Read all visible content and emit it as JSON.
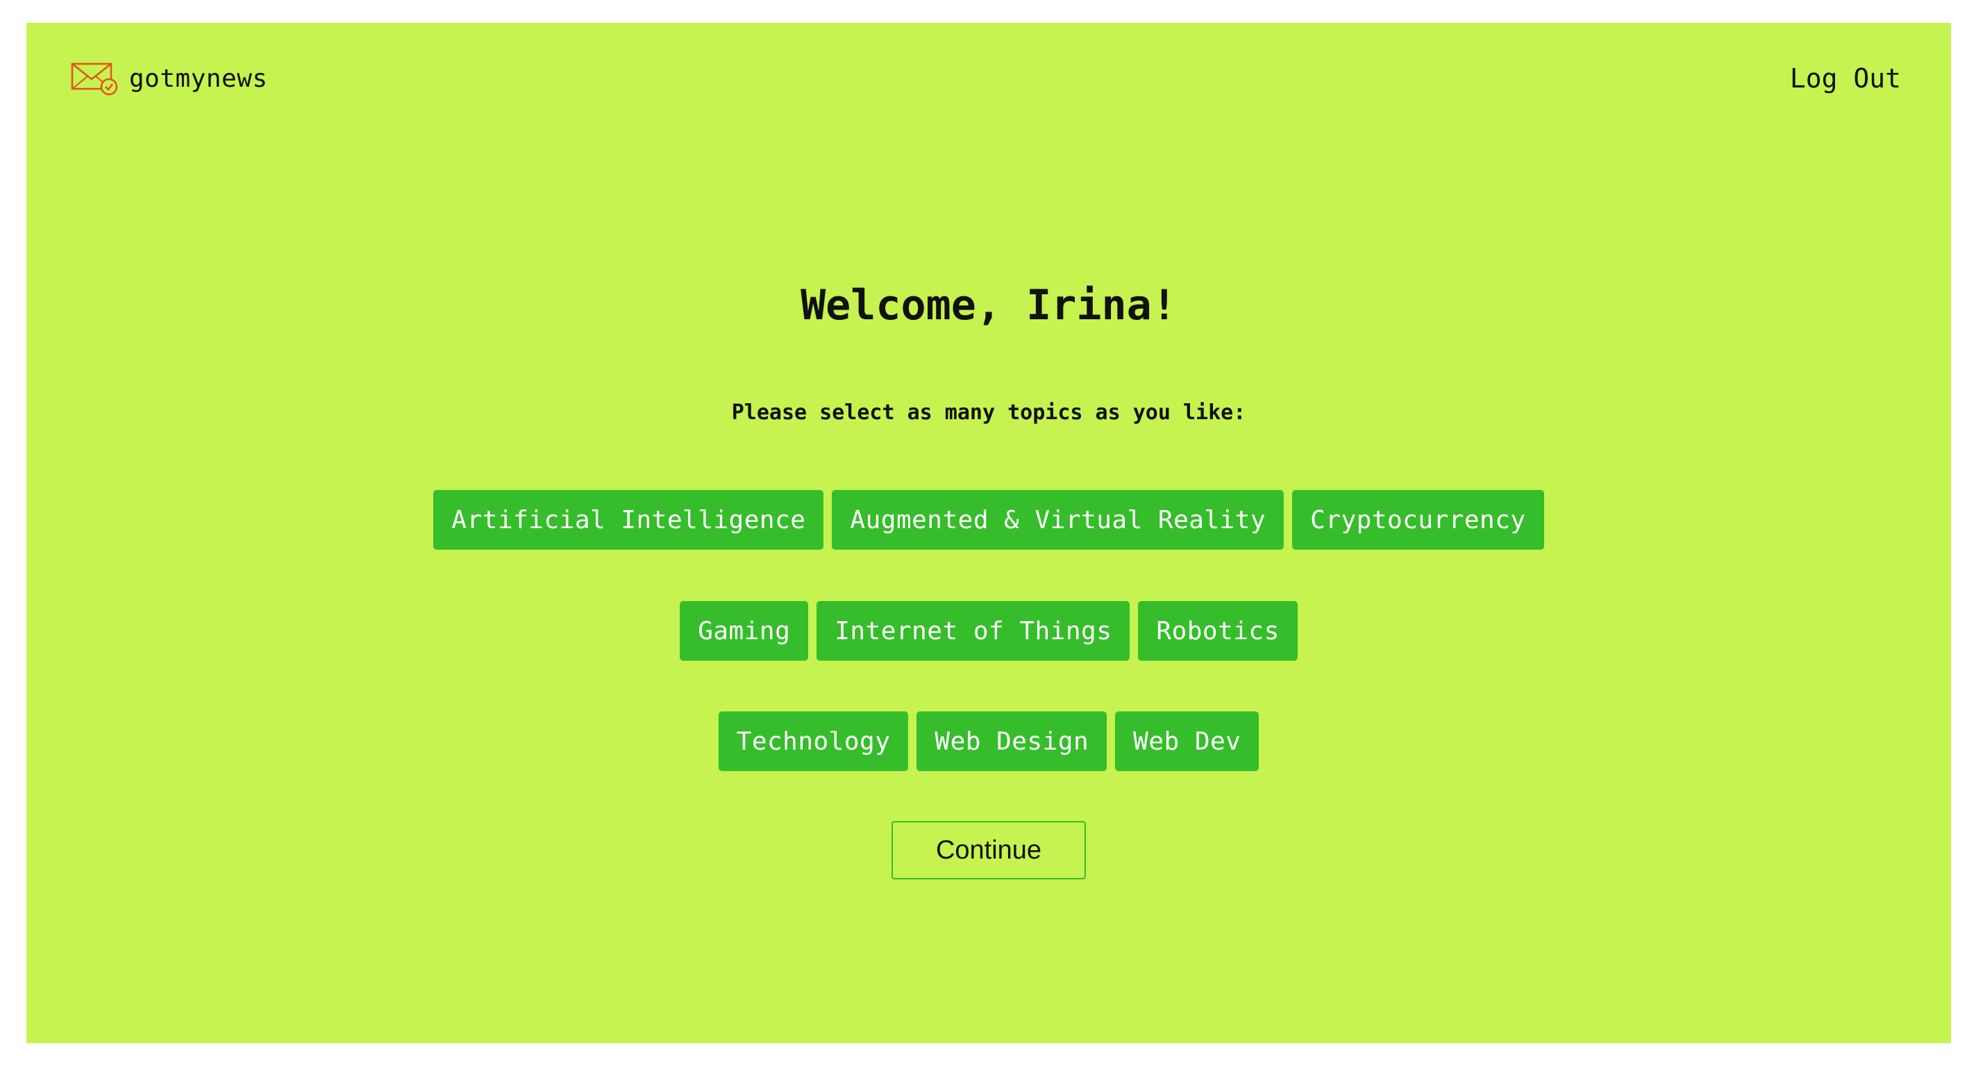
{
  "header": {
    "brand_name": "gotmynews",
    "brand_icon": "envelope-check-icon",
    "logout_label": "Log Out"
  },
  "main": {
    "welcome": "Welcome, Irina!",
    "subtitle": "Please select as many topics as you like:",
    "topic_rows": [
      [
        "Artificial Intelligence",
        "Augmented & Virtual Reality",
        "Cryptocurrency"
      ],
      [
        "Gaming",
        "Internet of Things",
        "Robotics"
      ],
      [
        "Technology",
        "Web Design",
        "Web Dev"
      ]
    ],
    "continue_label": "Continue"
  },
  "colors": {
    "background": "#c6f34f",
    "topic_button": "#36bd2b",
    "topic_text": "#ffffff",
    "icon_accent": "#e8501f"
  }
}
